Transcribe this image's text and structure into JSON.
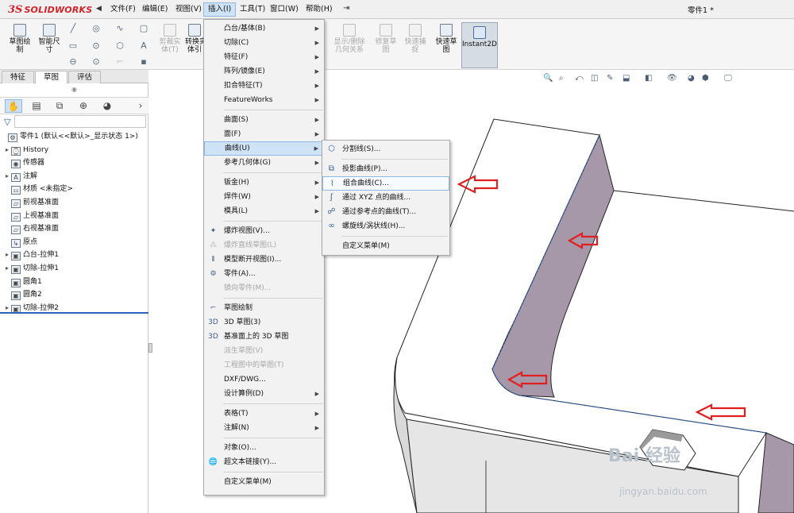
{
  "app": {
    "logo_mark": "3S",
    "logo_text": "SOLIDWORKS",
    "doc_title": "零件1 *"
  },
  "menubar": [
    {
      "label": "文件(F)"
    },
    {
      "label": "编辑(E)"
    },
    {
      "label": "视图(V)"
    },
    {
      "label": "插入(I)",
      "active": true
    },
    {
      "label": "工具(T)"
    },
    {
      "label": "窗口(W)"
    },
    {
      "label": "帮助(H)"
    }
  ],
  "toolbar": {
    "sketch": "草图绘\n制",
    "smart_dim": "智能尺\n寸",
    "trim": "剪裁实\n体(T)",
    "convert": "转换实\n体引",
    "display_relations": "显示/删除\n几何关系",
    "repair_sketch": "修复草\n图",
    "quick_snap": "快速捕\n捉",
    "quick_sketch": "快速草\n图",
    "instant2d": "Instant2D"
  },
  "tabs": [
    "特征",
    "草图",
    "评估"
  ],
  "tree": [
    {
      "label": "零件1 (默认<<默认>_显示状态 1>)",
      "caret": "",
      "icon": "part",
      "indent": 0
    },
    {
      "label": "History",
      "caret": "▸",
      "icon": "history",
      "indent": 1
    },
    {
      "label": "传感器",
      "caret": "",
      "icon": "sensor",
      "indent": 1
    },
    {
      "label": "注解",
      "caret": "▸",
      "icon": "annotation",
      "indent": 1
    },
    {
      "label": "材质 <未指定>",
      "caret": "",
      "icon": "material",
      "indent": 1
    },
    {
      "label": "前视基准面",
      "caret": "",
      "icon": "plane",
      "indent": 1
    },
    {
      "label": "上视基准面",
      "caret": "",
      "icon": "plane",
      "indent": 1
    },
    {
      "label": "右视基准面",
      "caret": "",
      "icon": "plane",
      "indent": 1
    },
    {
      "label": "原点",
      "caret": "",
      "icon": "origin",
      "indent": 1
    },
    {
      "label": "凸台-拉伸1",
      "caret": "▸",
      "icon": "boss",
      "indent": 1
    },
    {
      "label": "切除-拉伸1",
      "caret": "▸",
      "icon": "cut",
      "indent": 1
    },
    {
      "label": "圆角1",
      "caret": "",
      "icon": "fillet",
      "indent": 1
    },
    {
      "label": "圆角2",
      "caret": "",
      "icon": "fillet",
      "indent": 1
    },
    {
      "label": "切除-拉伸2",
      "caret": "▸",
      "icon": "cut",
      "indent": 1
    }
  ],
  "insert_menu": [
    {
      "label": "凸台/基体(B)",
      "arrow": true
    },
    {
      "label": "切除(C)",
      "arrow": true
    },
    {
      "label": "特征(F)",
      "arrow": true
    },
    {
      "label": "阵列/镜像(E)",
      "arrow": true
    },
    {
      "label": "扣合特征(T)",
      "arrow": true
    },
    {
      "label": "FeatureWorks",
      "arrow": true
    },
    {
      "sep": true
    },
    {
      "label": "曲面(S)",
      "arrow": true
    },
    {
      "label": "面(F)",
      "arrow": true
    },
    {
      "label": "曲线(U)",
      "arrow": true,
      "highlight": true
    },
    {
      "label": "参考几何体(G)",
      "arrow": true
    },
    {
      "sep": true
    },
    {
      "label": "钣金(H)",
      "arrow": true
    },
    {
      "label": "焊件(W)",
      "arrow": true
    },
    {
      "label": "模具(L)",
      "arrow": true
    },
    {
      "sep": true
    },
    {
      "label": "爆炸视图(V)...",
      "icon": "explode-icon"
    },
    {
      "label": "爆炸直线草图(L)",
      "icon": "explode-line-icon",
      "disabled": true
    },
    {
      "label": "模型断开视图(I)...",
      "icon": "break-view-icon"
    },
    {
      "label": "零件(A)...",
      "icon": "part-icon"
    },
    {
      "label": "镜向零件(M)...",
      "disabled": true
    },
    {
      "sep": true
    },
    {
      "label": "草图绘制",
      "icon": "sketch-icon"
    },
    {
      "label": "3D 草图(3)",
      "icon": "sketch3d-icon"
    },
    {
      "label": "基准面上的 3D 草图",
      "icon": "sketch3d-plane-icon"
    },
    {
      "label": "派生草图(V)",
      "disabled": true
    },
    {
      "label": "工程图中的草图(T)",
      "disabled": true
    },
    {
      "label": "DXF/DWG..."
    },
    {
      "label": "设计算例(D)",
      "arrow": true
    },
    {
      "sep": true
    },
    {
      "label": "表格(T)",
      "arrow": true
    },
    {
      "label": "注解(N)",
      "arrow": true
    },
    {
      "sep": true
    },
    {
      "label": "对象(O)..."
    },
    {
      "label": "超文本链接(Y)...",
      "icon": "hyperlink-icon"
    },
    {
      "sep": true
    },
    {
      "label": "自定义菜单(M)"
    }
  ],
  "curve_menu": [
    {
      "label": "分割线(S)...",
      "icon": "split-line-icon"
    },
    {
      "sep": true
    },
    {
      "label": "投影曲线(P)...",
      "icon": "projected-curve-icon"
    },
    {
      "label": "组合曲线(C)...",
      "icon": "composite-curve-icon",
      "highlight": true
    },
    {
      "label": "通过 XYZ 点的曲线...",
      "icon": "xyz-curve-icon"
    },
    {
      "label": "通过参考点的曲线(T)...",
      "icon": "ref-point-curve-icon"
    },
    {
      "label": "螺旋线/涡状线(H)...",
      "icon": "helix-icon"
    },
    {
      "sep": true
    },
    {
      "label": "自定义菜单(M)"
    }
  ],
  "watermark": {
    "main": "Bai 经验",
    "sub": "jingyan.baidu.com"
  },
  "colors": {
    "accent": "#2b63b8",
    "logo_red": "#d2232a",
    "highlight": "#cfe3f7",
    "arrow_red": "#e02020",
    "face_purple": "#a698a8"
  }
}
